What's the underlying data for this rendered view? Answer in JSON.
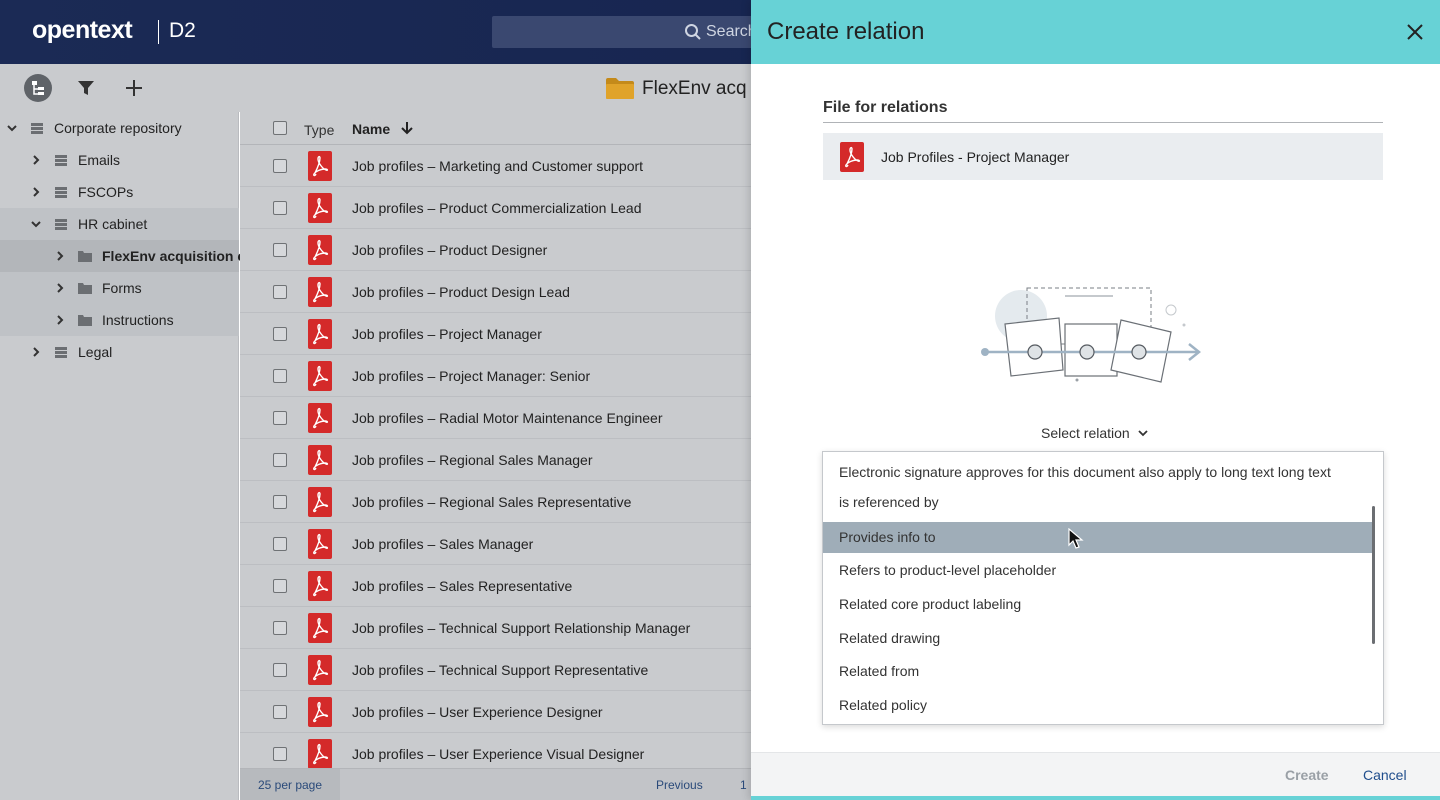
{
  "header": {
    "logo_text": "opentext",
    "product": "D2",
    "search_placeholder": "Search"
  },
  "toolbar": {
    "icons": [
      "repository-tree-icon",
      "filter-icon",
      "add-icon"
    ],
    "folder_title": "FlexEnv acq"
  },
  "sidebar": {
    "items": [
      {
        "label": "Corporate repository",
        "level": 0,
        "expanded": true
      },
      {
        "label": "Emails",
        "level": 1,
        "expanded": false
      },
      {
        "label": "FSCOPs",
        "level": 1,
        "expanded": false
      },
      {
        "label": "HR cabinet",
        "level": 1,
        "expanded": true
      },
      {
        "label": "FlexEnv acquisition exp",
        "level": 2,
        "expanded": false,
        "selected": true
      },
      {
        "label": "Forms",
        "level": 2,
        "expanded": false
      },
      {
        "label": "Instructions",
        "level": 2,
        "expanded": false
      },
      {
        "label": "Legal",
        "level": 1,
        "expanded": false
      }
    ]
  },
  "list": {
    "columns": {
      "type": "Type",
      "name": "Name"
    },
    "rows": [
      "Job profiles – Marketing and Customer support",
      "Job profiles – Product Commercialization Lead",
      "Job profiles – Product Designer",
      "Job profiles – Product Design Lead",
      "Job profiles – Project Manager",
      "Job profiles – Project Manager: Senior",
      "Job profiles – Radial Motor Maintenance Engineer",
      "Job profiles – Regional Sales Manager",
      "Job profiles – Regional Sales Representative",
      "Job profiles – Sales Manager",
      "Job profiles – Sales Representative",
      "Job profiles – Technical Support Relationship Manager",
      "Job profiles – Technical Support Representative",
      "Job profiles – User Experience Designer",
      "Job profiles – User Experience Visual Designer"
    ],
    "pager": {
      "per_page": "25 per page",
      "previous": "Previous",
      "page": "1"
    }
  },
  "dialog": {
    "title": "Create relation",
    "section_label": "File for relations",
    "file_name": "Job Profiles - Project Manager",
    "select_label": "Select relation",
    "options": [
      "Electronic signature approves for this document also apply to long text long text",
      "is referenced by",
      "Provides info to",
      "Refers to product-level placeholder",
      "Related core product labeling",
      "Related drawing",
      "Related from",
      "Related policy"
    ],
    "hovered_option": "Provides info to",
    "create_label": "Create",
    "cancel_label": "Cancel"
  },
  "colors": {
    "header_bg": "#1b2a55",
    "dialog_accent": "#67d2d6",
    "pdf_red": "#d42a2a",
    "panel_gray": "#c9cbce"
  }
}
